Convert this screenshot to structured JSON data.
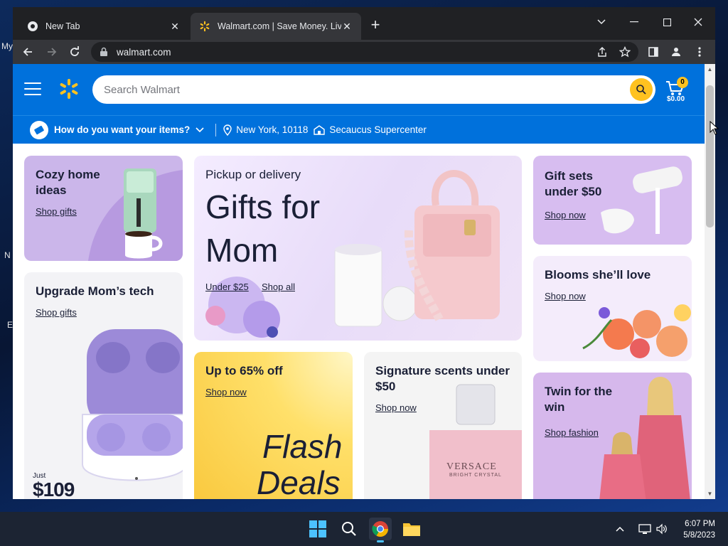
{
  "desktop": {
    "fragments": [
      "My",
      "N",
      "E"
    ]
  },
  "browser": {
    "tabs": [
      {
        "title": "New Tab",
        "favicon": "chrome-icon"
      },
      {
        "title": "Walmart.com | Save Money. Live",
        "favicon": "walmart-spark-icon"
      }
    ],
    "url": "walmart.com"
  },
  "walmart": {
    "search_placeholder": "Search Walmart",
    "cart": {
      "count": "0",
      "total": "$0.00"
    },
    "subheader": {
      "question": "How do you want your items?",
      "location": "New York, 10118",
      "store": "Secaucus Supercenter"
    },
    "tiles": {
      "cozy": {
        "title": "Cozy home ideas",
        "link": "Shop gifts"
      },
      "tech": {
        "title": "Upgrade Mom’s tech",
        "link": "Shop gifts",
        "price_prefix": "Just",
        "price": "$109"
      },
      "mom": {
        "eyebrow": "Pickup or delivery",
        "title": "Gifts for Mom",
        "link1": "Under $25",
        "link2": "Shop all"
      },
      "flash": {
        "title": "Up to 65% off",
        "link": "Shop now",
        "headline_1": "Flash",
        "headline_2": "Deals"
      },
      "scents": {
        "title": "Signature scents under $50",
        "link": "Shop now",
        "bottle_brand": "VERSACE",
        "bottle_sub": "BRIGHT CRYSTAL"
      },
      "gift": {
        "title": "Gift sets under $50",
        "link": "Shop now"
      },
      "blooms": {
        "title": "Blooms she’ll love",
        "link": "Shop now"
      },
      "twin": {
        "title": "Twin for the win",
        "link": "Shop fashion"
      }
    },
    "colors": {
      "brand_blue": "#0071dc",
      "spark_yellow": "#ffc220"
    }
  },
  "taskbar": {
    "time": "6:07 PM",
    "date": "5/8/2023"
  }
}
